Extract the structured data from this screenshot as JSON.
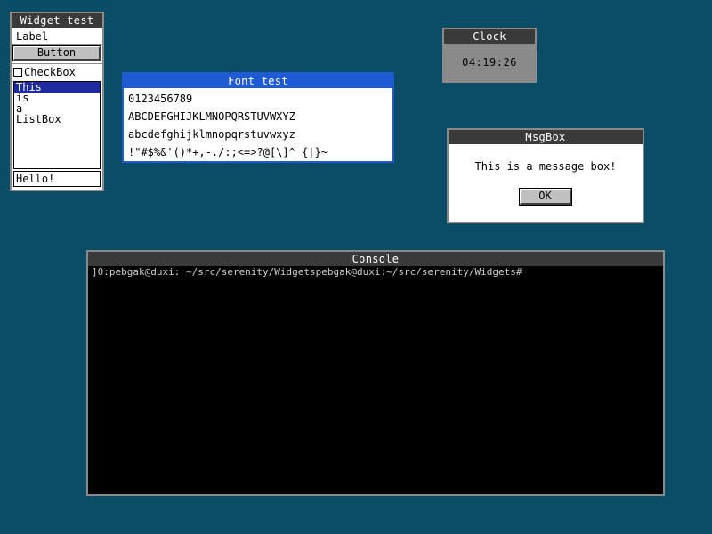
{
  "widget_test": {
    "title": "Widget test",
    "label": "Label",
    "button_label": "Button",
    "checkbox_label": "CheckBox",
    "listbox_items": [
      "This",
      "is",
      "a",
      "ListBox"
    ],
    "textbox_value": "Hello!"
  },
  "font_test": {
    "title": "Font test",
    "lines": [
      "0123456789",
      "ABCDEFGHIJKLMNOPQRSTUVWXYZ",
      "abcdefghijklmnopqrstuvwxyz",
      "!\"#$%&'()*+,-./:;<=>?@[\\]^_{|}~"
    ]
  },
  "clock": {
    "title": "Clock",
    "time": "04:19:26"
  },
  "msgbox": {
    "title": "MsgBox",
    "message": "This is a message box!",
    "ok_label": "OK"
  },
  "console": {
    "title": "Console",
    "output": "]0:pebgak@duxi: ~/src/serenity/Widgetspebgak@duxi:~/src/serenity/Widgets#"
  },
  "colors": {
    "desktop": "#0b4d66",
    "active_title": "#1e5bd4",
    "inactive_title": "#3a3a3a",
    "list_selection": "#1e2aa0"
  }
}
